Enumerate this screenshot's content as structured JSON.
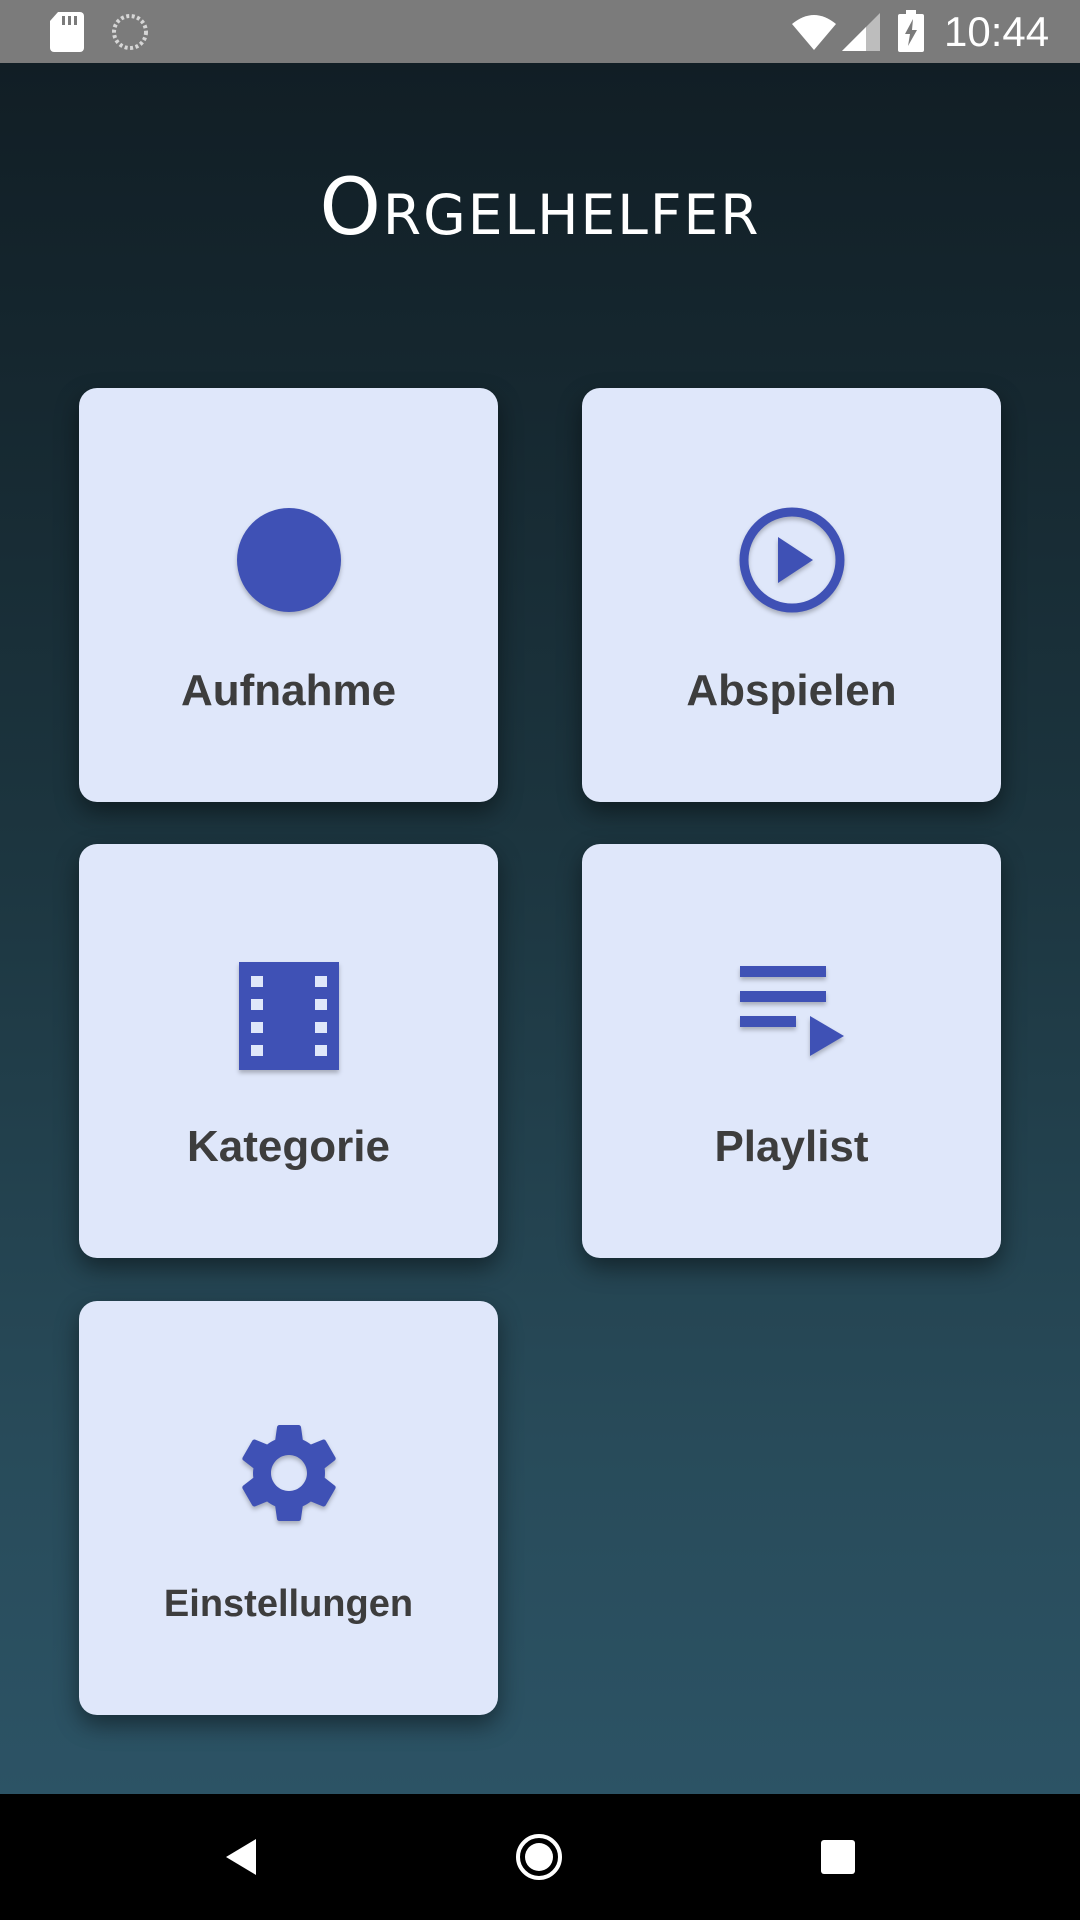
{
  "status_bar": {
    "time": "10:44",
    "icons": [
      "sd-card-icon",
      "sync-icon",
      "wifi-icon",
      "signal-icon",
      "battery-charging-icon"
    ]
  },
  "app": {
    "title": "Orgelhelfer"
  },
  "tiles": [
    {
      "label": "Aufnahme",
      "icon": "record-icon"
    },
    {
      "label": "Abspielen",
      "icon": "play-circle-icon"
    },
    {
      "label": "Kategorie",
      "icon": "movie-icon"
    },
    {
      "label": "Playlist",
      "icon": "playlist-play-icon"
    },
    {
      "label": "Einstellungen",
      "icon": "gear-icon"
    }
  ],
  "nav_bar": {
    "icons": [
      "back-icon",
      "home-icon",
      "recents-icon"
    ]
  },
  "colors": {
    "accent": "#3f51b5",
    "tile_background": "#dfe7fa",
    "tile_text": "#3d3d3d",
    "status_bar": "#7b7b7b",
    "background_top": "#111e25",
    "background_bottom": "#2c5365"
  }
}
